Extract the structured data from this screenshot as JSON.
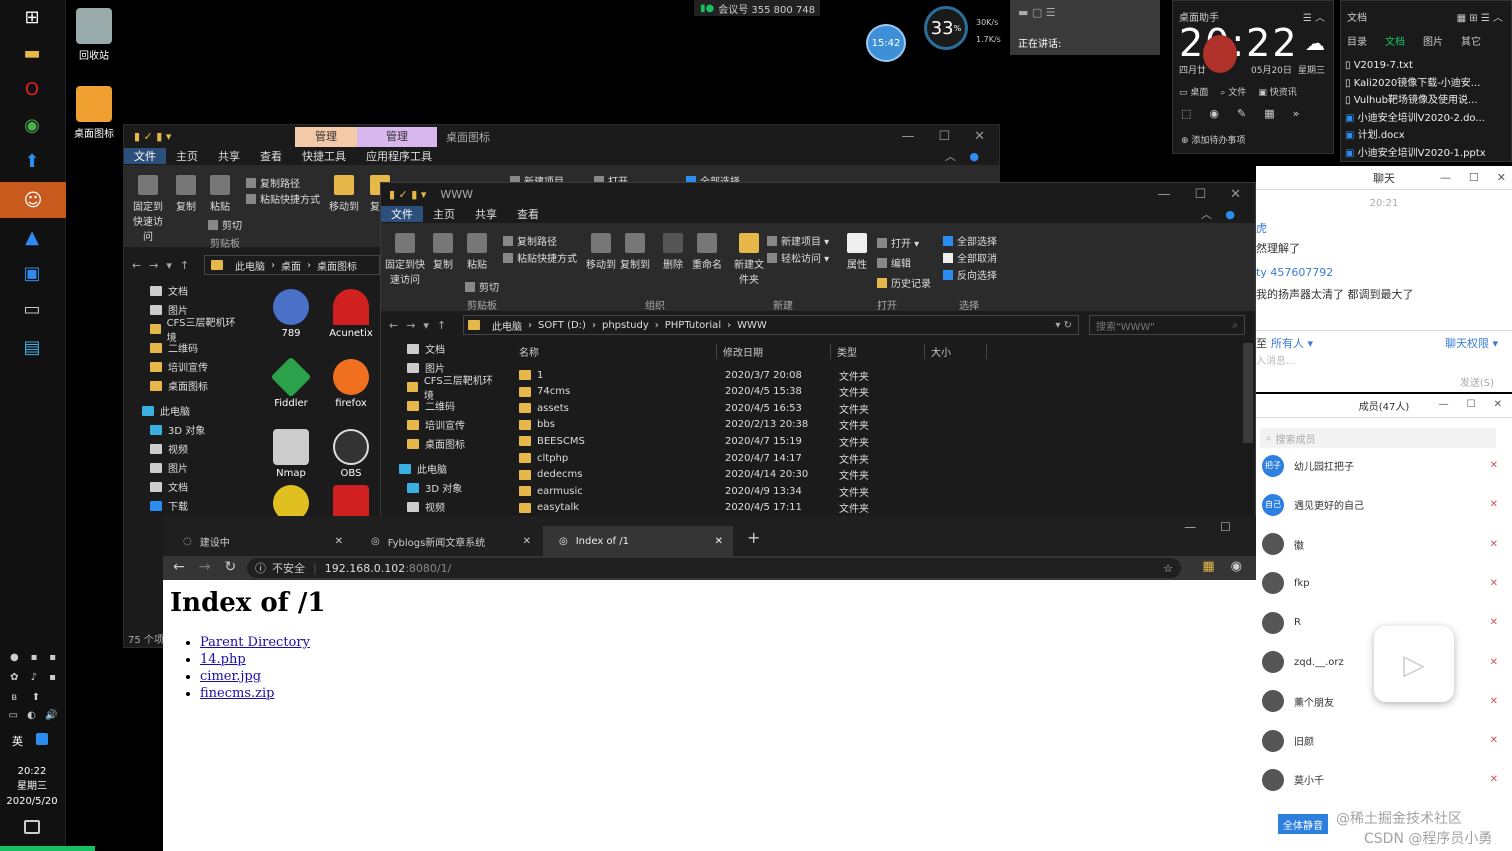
{
  "taskbar": {
    "clock_time": "20:22",
    "clock_day": "星期三",
    "clock_date": "2020/5/20",
    "lang": "英"
  },
  "meeting": {
    "label": "会议号 355 800 748"
  },
  "speaking": {
    "label": "正在讲话:"
  },
  "speed": {
    "percent": "33",
    "pct_sign": "%",
    "up": "30K/s",
    "down": "1.7K/s",
    "circle_time": "15:42"
  },
  "desktop": {
    "recycle": "回收站",
    "icons": "桌面图标",
    "apps": [
      "789",
      "Acunetix",
      "Fiddler",
      "firefox",
      "Nmap",
      "OBS"
    ]
  },
  "assistant": {
    "title": "桌面助手",
    "time": "20:22",
    "date1": "四月廿",
    "date2": "05月20日",
    "weekday": "星期三",
    "btn_desktop": "桌面",
    "btn_file": "文件",
    "btn_news": "快资讯",
    "add_todo": "添加待办事项"
  },
  "docs": {
    "title": "文档",
    "tabs": [
      "目录",
      "文档",
      "图片",
      "其它"
    ],
    "files": [
      "V2019-7.txt",
      "Kali2020镜像下载-小迪安...",
      "Vulhub靶场镜像及使用说...",
      "小迪安全培训V2020-2.do...",
      "计划.docx",
      "小迪安全培训V2020-1.pptx"
    ]
  },
  "explorer1": {
    "tab_manage1": "管理",
    "tab_manage2": "管理",
    "title": "桌面图标",
    "menu": [
      "文件",
      "主页",
      "共享",
      "查看",
      "快捷工具",
      "应用程序工具"
    ],
    "ribbon": {
      "pin": "固定到快速访问",
      "copy": "复制",
      "paste": "粘贴",
      "copy_path": "复制路径",
      "paste_shortcut": "粘贴快捷方式",
      "cut": "剪切",
      "move_to": "移动到",
      "copy_to": "复制",
      "group_clipboard": "剪贴板",
      "new_item": "新建项目",
      "open": "打开",
      "select_all": "全部选择"
    },
    "path": [
      "此电脑",
      "桌面",
      "桌面图标"
    ],
    "nav": [
      "文档",
      "图片",
      "CFS三层靶机环境",
      "二维码",
      "培训宣传",
      "桌面图标",
      "此电脑",
      "3D 对象",
      "视频",
      "图片",
      "文档",
      "下载"
    ],
    "status": "75 个项"
  },
  "explorer2": {
    "title": "WWW",
    "menu": [
      "文件",
      "主页",
      "共享",
      "查看"
    ],
    "ribbon": {
      "pin": "固定到快速访问",
      "copy": "复制",
      "paste": "粘贴",
      "copy_path": "复制路径",
      "paste_shortcut": "粘贴快捷方式",
      "cut": "剪切",
      "move_to": "移动到",
      "copy_to": "复制到",
      "delete": "删除",
      "rename": "重命名",
      "new_folder": "新建文件夹",
      "new_item": "新建项目",
      "easy_access": "轻松访问",
      "properties": "属性",
      "open": "打开",
      "edit": "编辑",
      "history": "历史记录",
      "select_all": "全部选择",
      "select_none": "全部取消",
      "invert": "反向选择",
      "group_clipboard": "剪贴板",
      "group_organize": "组织",
      "group_new": "新建",
      "group_open": "打开",
      "group_select": "选择"
    },
    "path": [
      "此电脑",
      "SOFT (D:)",
      "phpstudy",
      "PHPTutorial",
      "WWW"
    ],
    "search_placeholder": "搜索\"WWW\"",
    "nav": [
      "文档",
      "图片",
      "CFS三层靶机环境",
      "二维码",
      "培训宣传",
      "桌面图标",
      "此电脑",
      "3D 对象",
      "视频"
    ],
    "columns": [
      "名称",
      "修改日期",
      "类型",
      "大小"
    ],
    "files": [
      [
        "1",
        "2020/3/7 20:08",
        "文件夹"
      ],
      [
        "74cms",
        "2020/4/5 15:38",
        "文件夹"
      ],
      [
        "assets",
        "2020/4/5 16:53",
        "文件夹"
      ],
      [
        "bbs",
        "2020/2/13 20:38",
        "文件夹"
      ],
      [
        "BEESCMS",
        "2020/4/7 15:19",
        "文件夹"
      ],
      [
        "cltphp",
        "2020/4/7 14:17",
        "文件夹"
      ],
      [
        "dedecms",
        "2020/4/14 20:30",
        "文件夹"
      ],
      [
        "earmusic",
        "2020/4/9 13:34",
        "文件夹"
      ],
      [
        "easytalk",
        "2020/4/5 17:11",
        "文件夹"
      ]
    ]
  },
  "browser": {
    "tabs": [
      "建设中",
      "Fyblogs新闻文章系统",
      "Index of /1"
    ],
    "not_secure": "不安全",
    "url_host": "192.168.0.102",
    "url_rest": ":8080/1/",
    "heading": "Index of /1",
    "links": [
      "Parent Directory",
      "14.php",
      "cimer.jpg",
      "finecms.zip"
    ]
  },
  "chat": {
    "title": "聊天",
    "time": "20:21",
    "msg1": "然理解了",
    "user": "ty 457607792",
    "msg2": "我的扬声器太清了 都调到最大了",
    "to_label": "至",
    "to_value": "所有人",
    "perm": "聊天权限",
    "input_placeholder": "入消息...",
    "send": "发送(S)"
  },
  "members": {
    "title": "成员(47人)",
    "search_placeholder": "搜索成员",
    "list": [
      "幼儿园扛把子",
      "遇见更好的自己",
      "徽",
      "fkp",
      "R",
      "zqd.__.orz",
      "薰个朋友",
      "旧颜",
      "莫小千"
    ],
    "avatar_labels": [
      "把子",
      "自己"
    ],
    "mute_all": "全体静音"
  },
  "watermark": {
    "line1": "@稀土掘金技术社区",
    "line2": "CSDN @程序员小勇"
  }
}
